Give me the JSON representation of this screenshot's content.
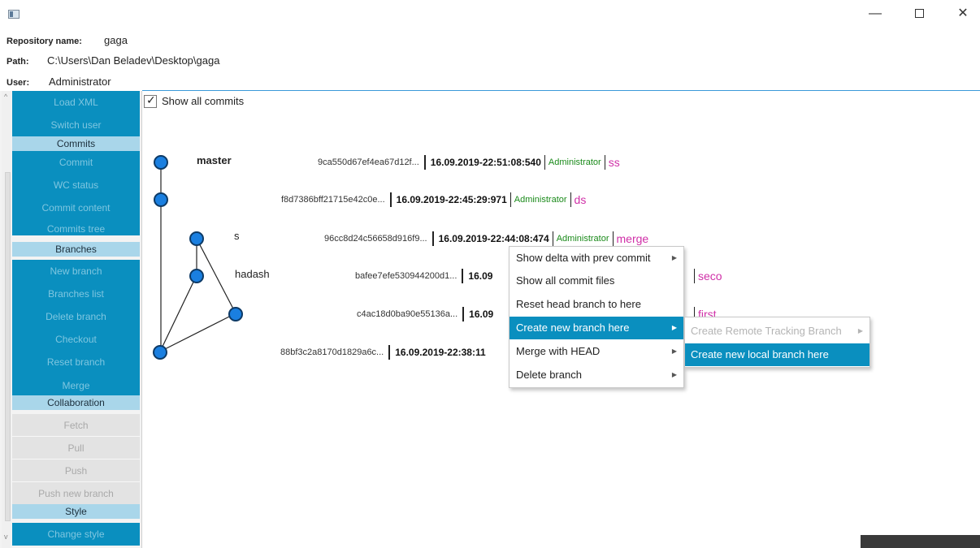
{
  "window": {
    "icon": "app-window-icon",
    "controls": {
      "minimize": "—",
      "close": "✕"
    }
  },
  "info": {
    "repo_label": "Repository name:",
    "repo_value": "gaga",
    "path_label": "Path:",
    "path_value": "C:\\Users\\Dan Beladev\\Desktop\\gaga",
    "user_label": "User:",
    "user_value": "Administrator"
  },
  "sidebar": {
    "load_xml": "Load XML",
    "switch_user": "Switch user",
    "commits_header": "Commits",
    "commit": "Commit",
    "wc_status": "WC status",
    "commit_content": "Commit content",
    "commits_tree": "Commits tree",
    "branches_header": "Branches",
    "new_branch": "New branch",
    "branches_list": "Branches list",
    "delete_branch": "Delete branch",
    "checkout": "Checkout",
    "reset_branch": "Reset branch",
    "merge": "Merge",
    "collaboration_header": "Collaboration",
    "fetch": "Fetch",
    "pull": "Pull",
    "push": "Push",
    "push_new_branch": "Push new branch",
    "style_header": "Style",
    "change_style": "Change style"
  },
  "main": {
    "show_all_commits": "Show all commits"
  },
  "graph": {
    "branch_labels": {
      "master": "master",
      "s": "s",
      "hadash": "hadash"
    },
    "commits": [
      {
        "sha": "9ca550d67ef4ea67d12f...",
        "date": "16.09.2019-22:51:08:540",
        "author": "Administrator",
        "message": "ss"
      },
      {
        "sha": "f8d7386bff21715e42c0e...",
        "date": "16.09.2019-22:45:29:971",
        "author": "Administrator",
        "message": "ds"
      },
      {
        "sha": "96cc8d24c56658d916f9...",
        "date": "16.09.2019-22:44:08:474",
        "author": "Administrator",
        "message": "merge"
      },
      {
        "sha": "bafee7efe530944200d1...",
        "date": "16.09",
        "message": "seco"
      },
      {
        "sha": "c4ac18d0ba90e55136a...",
        "date": "16.09",
        "message": "first"
      },
      {
        "sha": "88bf3c2a8170d1829a6c...",
        "date": "16.09.2019-22:38:11"
      }
    ]
  },
  "context_menu": {
    "items": [
      "Show delta with prev commit",
      "Show all commit files",
      "Reset head branch to here",
      "Create new branch here",
      "Merge with HEAD",
      "Delete branch"
    ]
  },
  "submenu": {
    "items": [
      "Create Remote Tracking Branch",
      "Create new local branch here"
    ]
  },
  "colors": {
    "accent": "#0a8fbf",
    "section_header": "#a9d6ea",
    "node_fill": "#1a7fe0",
    "author": "#1a8a1a",
    "message": "#d030a8"
  }
}
